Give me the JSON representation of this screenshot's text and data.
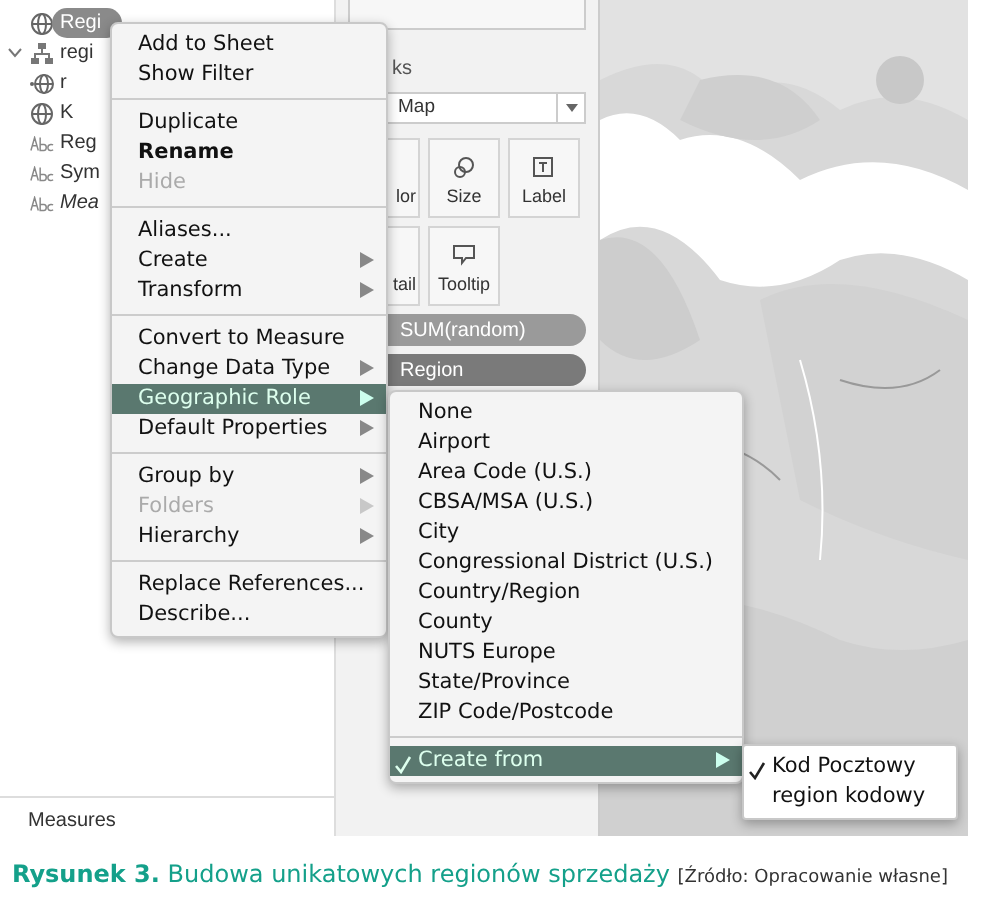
{
  "data_pane": {
    "fields": [
      {
        "kind": "geo",
        "label": "Regi",
        "selected": true,
        "italic": false
      },
      {
        "kind": "hierarchy",
        "label": "regi",
        "selected": false,
        "italic": false
      },
      {
        "kind": "geo-child",
        "label": "r",
        "selected": false,
        "italic": false
      },
      {
        "kind": "geo",
        "label": "K",
        "selected": false,
        "italic": false
      },
      {
        "kind": "string",
        "label": "Reg",
        "selected": false,
        "italic": false
      },
      {
        "kind": "string",
        "label": "Sym",
        "selected": false,
        "italic": false
      },
      {
        "kind": "string",
        "label": "Mea",
        "selected": false,
        "italic": true
      }
    ],
    "measures_label": "Measures"
  },
  "marks": {
    "title": "ks",
    "mark_type": "Map",
    "cards": [
      {
        "label": "lor",
        "kind": "dots"
      },
      {
        "label": "Size",
        "kind": "size"
      },
      {
        "label": "Label",
        "kind": "label"
      },
      {
        "label": "tail",
        "kind": "detail"
      },
      {
        "label": "Tooltip",
        "kind": "tooltip"
      }
    ],
    "pills": [
      {
        "label": "SUM(random)",
        "selected": false
      },
      {
        "label": "Region",
        "selected": true
      }
    ]
  },
  "context_menu": [
    {
      "kind": "item",
      "label": "Add to Sheet",
      "bold": false,
      "disabled": false,
      "submenu": false,
      "selected": false
    },
    {
      "kind": "item",
      "label": "Show Filter",
      "bold": false,
      "disabled": false,
      "submenu": false,
      "selected": false
    },
    {
      "kind": "separator"
    },
    {
      "kind": "item",
      "label": "Duplicate",
      "bold": false,
      "disabled": false,
      "submenu": false,
      "selected": false
    },
    {
      "kind": "item",
      "label": "Rename",
      "bold": true,
      "disabled": false,
      "submenu": false,
      "selected": false
    },
    {
      "kind": "item",
      "label": "Hide",
      "bold": false,
      "disabled": true,
      "submenu": false,
      "selected": false
    },
    {
      "kind": "separator"
    },
    {
      "kind": "item",
      "label": "Aliases...",
      "bold": false,
      "disabled": false,
      "submenu": false,
      "selected": false
    },
    {
      "kind": "item",
      "label": "Create",
      "bold": false,
      "disabled": false,
      "submenu": true,
      "selected": false
    },
    {
      "kind": "item",
      "label": "Transform",
      "bold": false,
      "disabled": false,
      "submenu": true,
      "selected": false
    },
    {
      "kind": "separator"
    },
    {
      "kind": "item",
      "label": "Convert to Measure",
      "bold": false,
      "disabled": false,
      "submenu": false,
      "selected": false
    },
    {
      "kind": "item",
      "label": "Change Data Type",
      "bold": false,
      "disabled": false,
      "submenu": true,
      "selected": false
    },
    {
      "kind": "item",
      "label": "Geographic Role",
      "bold": false,
      "disabled": false,
      "submenu": true,
      "selected": true
    },
    {
      "kind": "item",
      "label": "Default Properties",
      "bold": false,
      "disabled": false,
      "submenu": true,
      "selected": false
    },
    {
      "kind": "separator"
    },
    {
      "kind": "item",
      "label": "Group by",
      "bold": false,
      "disabled": false,
      "submenu": true,
      "selected": false
    },
    {
      "kind": "item",
      "label": "Folders",
      "bold": false,
      "disabled": true,
      "submenu": true,
      "selected": false
    },
    {
      "kind": "item",
      "label": "Hierarchy",
      "bold": false,
      "disabled": false,
      "submenu": true,
      "selected": false
    },
    {
      "kind": "separator"
    },
    {
      "kind": "item",
      "label": "Replace References...",
      "bold": false,
      "disabled": false,
      "submenu": false,
      "selected": false
    },
    {
      "kind": "item",
      "label": "Describe...",
      "bold": false,
      "disabled": false,
      "submenu": false,
      "selected": false
    }
  ],
  "geographic_role_menu": [
    {
      "kind": "item",
      "label": "None",
      "checked": false,
      "submenu": false,
      "selected": false
    },
    {
      "kind": "item",
      "label": "Airport",
      "checked": false,
      "submenu": false,
      "selected": false
    },
    {
      "kind": "item",
      "label": "Area Code (U.S.)",
      "checked": false,
      "submenu": false,
      "selected": false
    },
    {
      "kind": "item",
      "label": "CBSA/MSA (U.S.)",
      "checked": false,
      "submenu": false,
      "selected": false
    },
    {
      "kind": "item",
      "label": "City",
      "checked": false,
      "submenu": false,
      "selected": false
    },
    {
      "kind": "item",
      "label": "Congressional District (U.S.)",
      "checked": false,
      "submenu": false,
      "selected": false
    },
    {
      "kind": "item",
      "label": "Country/Region",
      "checked": false,
      "submenu": false,
      "selected": false
    },
    {
      "kind": "item",
      "label": "County",
      "checked": false,
      "submenu": false,
      "selected": false
    },
    {
      "kind": "item",
      "label": "NUTS Europe",
      "checked": false,
      "submenu": false,
      "selected": false
    },
    {
      "kind": "item",
      "label": "State/Province",
      "checked": false,
      "submenu": false,
      "selected": false
    },
    {
      "kind": "item",
      "label": "ZIP Code/Postcode",
      "checked": false,
      "submenu": false,
      "selected": false
    },
    {
      "kind": "separator"
    },
    {
      "kind": "item",
      "label": "Create from",
      "checked": true,
      "submenu": true,
      "selected": true
    }
  ],
  "create_from_menu": [
    {
      "label": "Kod Pocztowy",
      "checked": true
    },
    {
      "label": "region kodowy",
      "checked": false
    }
  ],
  "caption": {
    "text": "**Rysunek 3.** Budowa unikatowych regionów sprzedaży",
    "source": "[Źródło: Opracowanie własne]"
  }
}
